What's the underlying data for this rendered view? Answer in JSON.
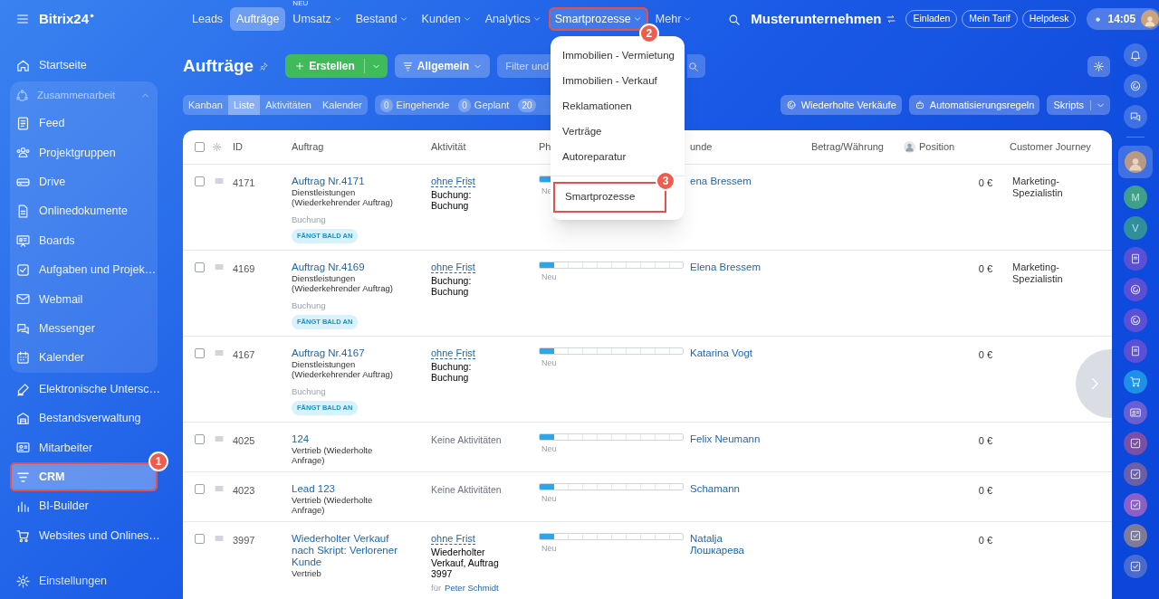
{
  "header": {
    "logo": "Bitrix24",
    "nav": [
      {
        "label": "Leads",
        "selected": false,
        "caret": false,
        "open": false
      },
      {
        "label": "Aufträge",
        "selected": true,
        "caret": false,
        "open": false
      },
      {
        "label": "Umsatz",
        "selected": false,
        "caret": true,
        "open": false,
        "badge": "NEU"
      },
      {
        "label": "Bestand",
        "selected": false,
        "caret": true,
        "open": false
      },
      {
        "label": "Kunden",
        "selected": false,
        "caret": true,
        "open": false
      },
      {
        "label": "Analytics",
        "selected": false,
        "caret": true,
        "open": false
      },
      {
        "label": "Smartprozesse",
        "selected": false,
        "caret": true,
        "open": true,
        "callout": "2"
      },
      {
        "label": "Mehr",
        "selected": false,
        "caret": true,
        "open": false
      }
    ],
    "company": "Musterunternehmen",
    "buttons": [
      "Einladen",
      "Mein Tarif",
      "Helpdesk"
    ],
    "time": "14:05"
  },
  "sidebar": {
    "items": [
      {
        "label": "Startseite",
        "selected": false
      },
      {
        "label": "Zusammenarbeit",
        "expanded": true,
        "children": [
          {
            "label": "Feed",
            "selected": false
          },
          {
            "label": "Projektgruppen",
            "selected": false
          },
          {
            "label": "Drive",
            "selected": false
          },
          {
            "label": "Onlinedokumente",
            "selected": false
          },
          {
            "label": "Boards",
            "selected": false
          },
          {
            "label": "Aufgaben und Projek…",
            "selected": false
          },
          {
            "label": "Webmail",
            "selected": false
          },
          {
            "label": "Messenger",
            "selected": false
          },
          {
            "label": "Kalender",
            "selected": false
          }
        ]
      },
      {
        "label": "Elektronische Untersc…",
        "selected": false
      },
      {
        "label": "Bestandsverwaltung",
        "selected": false
      },
      {
        "label": "Mitarbeiter",
        "selected": false
      },
      {
        "label": "CRM",
        "selected": true,
        "callout": "1"
      },
      {
        "label": "BI-Builder",
        "selected": false
      },
      {
        "label": "Websites und Onlines…",
        "selected": false
      }
    ],
    "footer": "Einstellungen"
  },
  "page": {
    "title": "Aufträge",
    "create_button": "Erstellen",
    "preset": "Allgemein",
    "filter": {
      "placeholder": "Filter und"
    },
    "views": [
      {
        "label": "Kanban",
        "selected": false
      },
      {
        "label": "Liste",
        "selected": true
      },
      {
        "label": "Aktivitäten",
        "selected": false
      },
      {
        "label": "Kalender",
        "selected": false
      }
    ],
    "counters": [
      {
        "count": "0",
        "label": "Eingehende"
      },
      {
        "count": "0",
        "label": "Geplant"
      },
      {
        "count": "20"
      }
    ],
    "actions": [
      "Wiederholte Verkäufe",
      "Automatisierungsregeln"
    ],
    "scripts_button": "Skripts"
  },
  "dropdown": {
    "items": [
      {
        "label": "Immobilien - Vermietung",
        "divider": false
      },
      {
        "label": "Immobilien - Verkauf",
        "divider": false
      },
      {
        "label": "Reklamationen",
        "divider": false
      },
      {
        "label": "Verträge",
        "divider": false
      },
      {
        "label": "Autoreparatur",
        "divider": false
      },
      {
        "label": "Smartprozesse",
        "divider": true,
        "callout": "3"
      }
    ]
  },
  "table": {
    "select_all": {
      "checked": false
    },
    "columns": [
      "ID",
      "Auftrag",
      "Aktivität",
      "Ph",
      "unde",
      "Betrag/Währung",
      "Position",
      "Customer Journey"
    ],
    "rows": [
      {
        "id": "4171",
        "checked": false,
        "title": "Auftrag Nr.4171",
        "subtitle": "Dienstleistungen (Wiederkehrender Auftrag)",
        "stage": "Buchung",
        "tag": "FÄNGT BALD AN",
        "activity": {
          "kind": "task",
          "deadline": "ohne Frist",
          "text": "Buchung: Buchung"
        },
        "phase": {
          "level": 0.1,
          "label": "Ne"
        },
        "client": "ena Bressem",
        "amount": "0 €",
        "position": "Marketing-Spezialistin"
      },
      {
        "id": "4169",
        "checked": false,
        "title": "Auftrag Nr.4169",
        "subtitle": "Dienstleistungen (Wiederkehrender Auftrag)",
        "stage": "Buchung",
        "tag": "FÄNGT BALD AN",
        "activity": {
          "kind": "task",
          "deadline": "ohne Frist",
          "text": "Buchung: Buchung"
        },
        "phase": {
          "level": 0.1,
          "label": "Neu"
        },
        "client": "Elena Bressem",
        "amount": "0 €",
        "position": "Marketing-Spezialistin"
      },
      {
        "id": "4167",
        "checked": false,
        "title": "Auftrag Nr.4167",
        "subtitle": "Dienstleistungen (Wiederkehrender Auftrag)",
        "stage": "Buchung",
        "tag": "FÄNGT BALD AN",
        "activity": {
          "kind": "task",
          "deadline": "ohne Frist",
          "text": "Buchung: Buchung"
        },
        "phase": {
          "level": 0.1,
          "label": "Neu"
        },
        "client": "Katarina Vogt",
        "amount": "0 €"
      },
      {
        "id": "4025",
        "checked": false,
        "title": "124",
        "subtitle": "Vertrieb (Wiederholte Anfrage)",
        "activity": {
          "kind": "none",
          "text": "Keine Aktivitäten"
        },
        "phase": {
          "level": 0.1,
          "label": "Neu"
        },
        "client": "Felix Neumann",
        "amount": "0 €"
      },
      {
        "id": "4023",
        "checked": false,
        "title": "Lead 123",
        "subtitle": "Vertrieb (Wiederholte Anfrage)",
        "activity": {
          "kind": "none",
          "text": "Keine Aktivitäten"
        },
        "phase": {
          "level": 0.1,
          "label": "Neu"
        },
        "client": "Schamann",
        "amount": "0 €"
      },
      {
        "id": "3997",
        "checked": false,
        "title": "Wiederholter Verkauf nach Skript: Verlorener Kunde",
        "subtitle": "Vertrieb",
        "activity": {
          "kind": "task",
          "deadline": "ohne Frist",
          "text": "Wiederholter Verkauf, Auftrag 3997",
          "for_label": "für",
          "responsible": "Peter Schmidt"
        },
        "phase": {
          "level": 0.1,
          "label": "Neu"
        },
        "client": "Natalja Лошкарева",
        "amount": "0 €"
      }
    ]
  },
  "rail": {
    "letters": [
      {
        "text": "M",
        "color": "#3f9f8a"
      },
      {
        "text": "V",
        "color": "#2f8f9c"
      }
    ]
  }
}
